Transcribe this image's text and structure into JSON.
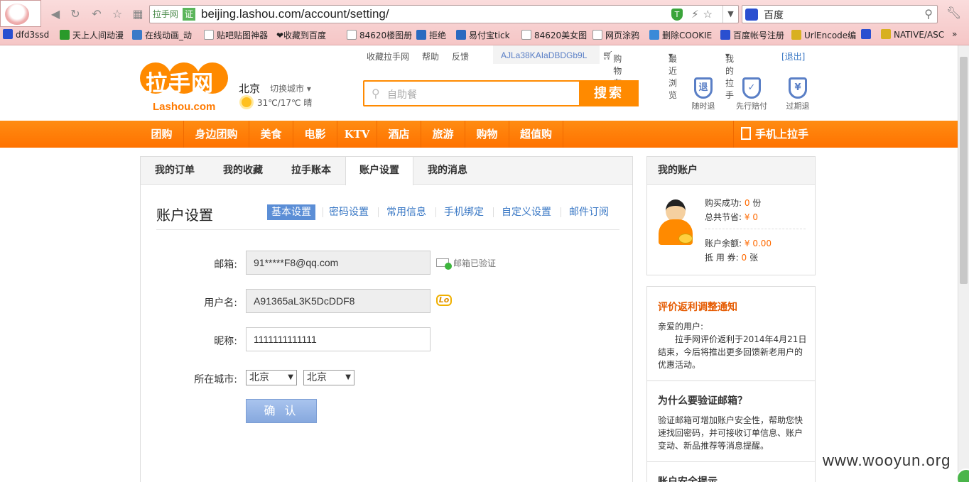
{
  "browser": {
    "url_site_label": "拉手网",
    "url_cert": "证",
    "url": "beijing.lashou.com/account/setting/",
    "search_engine": "百度",
    "bookmarks": [
      "dfd3ssd",
      "天上人间动漫",
      "在线动画_动",
      "贴吧贴图神器",
      "❤收藏到百度",
      "84620楼图册",
      "拒绝",
      "易付宝tick",
      "84620美女图",
      "网页涂鸦",
      "删除COOKIE",
      "百度帐号注册",
      "UrlEncode编",
      "NATIVE/ASC"
    ]
  },
  "toplinks": {
    "favorite": "收藏拉手网",
    "help": "帮助",
    "feedback": "反馈",
    "code": "AJLa38KAIaDBDGb9L",
    "cart": "购物车(0)",
    "recent": "最近浏览",
    "my_lashou": "我的拉手",
    "logout": "[退出]"
  },
  "header": {
    "logo_text": "拉手网",
    "logo_sub": "Lashou.com",
    "city": "北京",
    "switch_city": "切换城市",
    "weather": "31℃/17℃ 晴",
    "search_placeholder": "自助餐",
    "search_button": "搜索",
    "guarantees": [
      "随时退",
      "先行赔付",
      "过期退"
    ],
    "guarantee_glyphs": [
      "退",
      "✓",
      "¥"
    ]
  },
  "nav": {
    "items": [
      "团购",
      "身边团购",
      "美食",
      "电影",
      "KTV",
      "酒店",
      "旅游",
      "购物",
      "超值购"
    ],
    "mobile": "手机上拉手"
  },
  "main": {
    "tabs": [
      "我的订单",
      "我的收藏",
      "拉手账本",
      "账户设置",
      "我的消息"
    ],
    "active_tab": "账户设置",
    "title": "账户设置",
    "subnav": [
      "基本设置",
      "密码设置",
      "常用信息",
      "手机绑定",
      "自定义设置",
      "邮件订阅"
    ],
    "form": {
      "email_label": "邮箱:",
      "email_value": "91*****F8@qq.com",
      "email_status": "邮箱已验证",
      "username_label": "用户名:",
      "username_value": "A91365aL3K5DcDDF8",
      "username_badge": "Lo",
      "nickname_label": "昵称:",
      "nickname_value": "1111111111111",
      "city_label": "所在城市:",
      "province": "北京",
      "city": "北京",
      "confirm": "确 认"
    }
  },
  "sidebar": {
    "account_title": "我的账户",
    "stats": [
      {
        "label": "购买成功:",
        "value": "0",
        "unit": "份"
      },
      {
        "label": "总共节省:",
        "value": "¥ 0",
        "unit": ""
      },
      {
        "label": "账户余额:",
        "value": "¥ 0.00",
        "unit": ""
      },
      {
        "label": "抵 用 券:",
        "value": "0",
        "unit": "张"
      }
    ],
    "notice_title": "评价返利调整通知",
    "notice_greeting": "亲爱的用户:",
    "notice_body": "拉手网评价返利于2014年4月21日结束，今后将推出更多回馈新老用户的优惠活动。",
    "why_title": "为什么要验证邮箱？",
    "why_body": "验证邮箱可增加账户安全性，帮助您快速找回密码，并可接收订单信息、账户变动、新品推荐等消息提醒。",
    "security_title": "账户安全提示"
  },
  "watermark": "www.wooyun.org",
  "colors": {
    "brand": "#ff8a00",
    "link": "#3a78c5",
    "notice": "#e55a00"
  }
}
